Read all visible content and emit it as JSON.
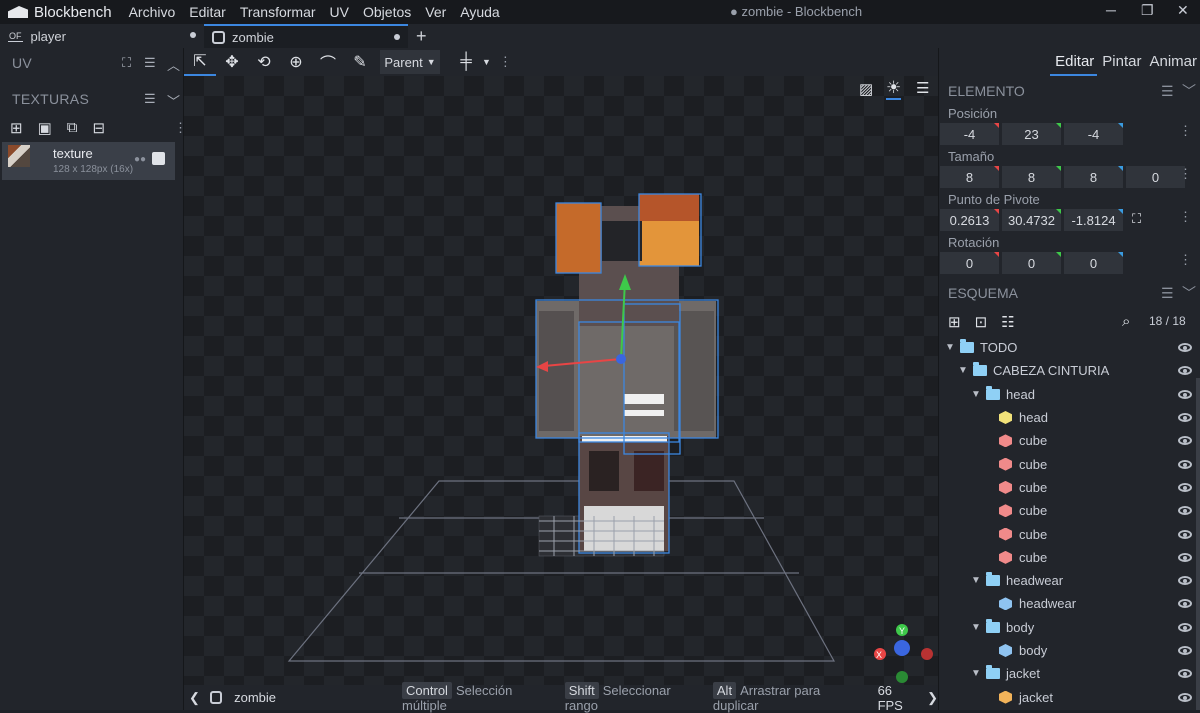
{
  "app": {
    "name": "Blockbench",
    "window_title": "● zombie - Blockbench",
    "menu": [
      "Archivo",
      "Editar",
      "Transformar",
      "UV",
      "Objetos",
      "Ver",
      "Ayuda"
    ]
  },
  "tabs": [
    {
      "label": "player",
      "icon": "player-model-icon",
      "active": false
    },
    {
      "label": "zombie",
      "icon": "zombie-model-icon",
      "active": true
    }
  ],
  "left": {
    "uv_title": "UV",
    "textures_title": "TEXTURAS",
    "texture": {
      "name": "texture",
      "size": "128 x 128px (16x)"
    }
  },
  "toolbar": {
    "pivot_dropdown": "Parent",
    "selected_tool": "move-tool-icon"
  },
  "modes": [
    "Editar",
    "Pintar",
    "Animar"
  ],
  "element": {
    "title": "ELEMENTO",
    "position_label": "Posición",
    "position": [
      "-4",
      "23",
      "-4"
    ],
    "size_label": "Tamaño",
    "size": [
      "8",
      "8",
      "8",
      "0"
    ],
    "pivot_label": "Punto de Pivote",
    "pivot": [
      "0.2613",
      "30.4732",
      "-1.8124"
    ],
    "rotation_label": "Rotación",
    "rotation": [
      "0",
      "0",
      "0"
    ]
  },
  "outliner": {
    "title": "ESQUEMA",
    "count": "18 / 18",
    "items": [
      {
        "label": "TODO",
        "kind": "folder",
        "depth": 0
      },
      {
        "label": "CABEZA CINTURIA",
        "kind": "folder",
        "depth": 1
      },
      {
        "label": "head",
        "kind": "folder",
        "depth": 2
      },
      {
        "label": "head",
        "kind": "cube",
        "color": "#f2e27a",
        "depth": 3
      },
      {
        "label": "cube",
        "kind": "cube",
        "color": "#f08a8a",
        "depth": 3
      },
      {
        "label": "cube",
        "kind": "cube",
        "color": "#f08a8a",
        "depth": 3
      },
      {
        "label": "cube",
        "kind": "cube",
        "color": "#f08a8a",
        "depth": 3
      },
      {
        "label": "cube",
        "kind": "cube",
        "color": "#f08a8a",
        "depth": 3
      },
      {
        "label": "cube",
        "kind": "cube",
        "color": "#f08a8a",
        "depth": 3
      },
      {
        "label": "cube",
        "kind": "cube",
        "color": "#f08a8a",
        "depth": 3
      },
      {
        "label": "headwear",
        "kind": "folder",
        "depth": 2
      },
      {
        "label": "headwear",
        "kind": "cube",
        "color": "#8fc3f0",
        "depth": 3
      },
      {
        "label": "body",
        "kind": "folder",
        "depth": 2
      },
      {
        "label": "body",
        "kind": "cube",
        "color": "#8fc3f0",
        "depth": 3
      },
      {
        "label": "jacket",
        "kind": "folder",
        "depth": 2
      },
      {
        "label": "jacket",
        "kind": "cube",
        "color": "#f2b35a",
        "depth": 3
      }
    ]
  },
  "status": {
    "model_name": "zombie",
    "hints": [
      {
        "key": "Control",
        "text": "Selección múltiple"
      },
      {
        "key": "Shift",
        "text": "Seleccionar rango"
      },
      {
        "key": "Alt",
        "text": "Arrastrar para duplicar"
      }
    ],
    "fps": "66 FPS"
  },
  "colors": {
    "accent": "#3c87e0",
    "x_axis": "#e84545",
    "y_axis": "#3ec94a",
    "z_axis": "#3a66e0"
  }
}
